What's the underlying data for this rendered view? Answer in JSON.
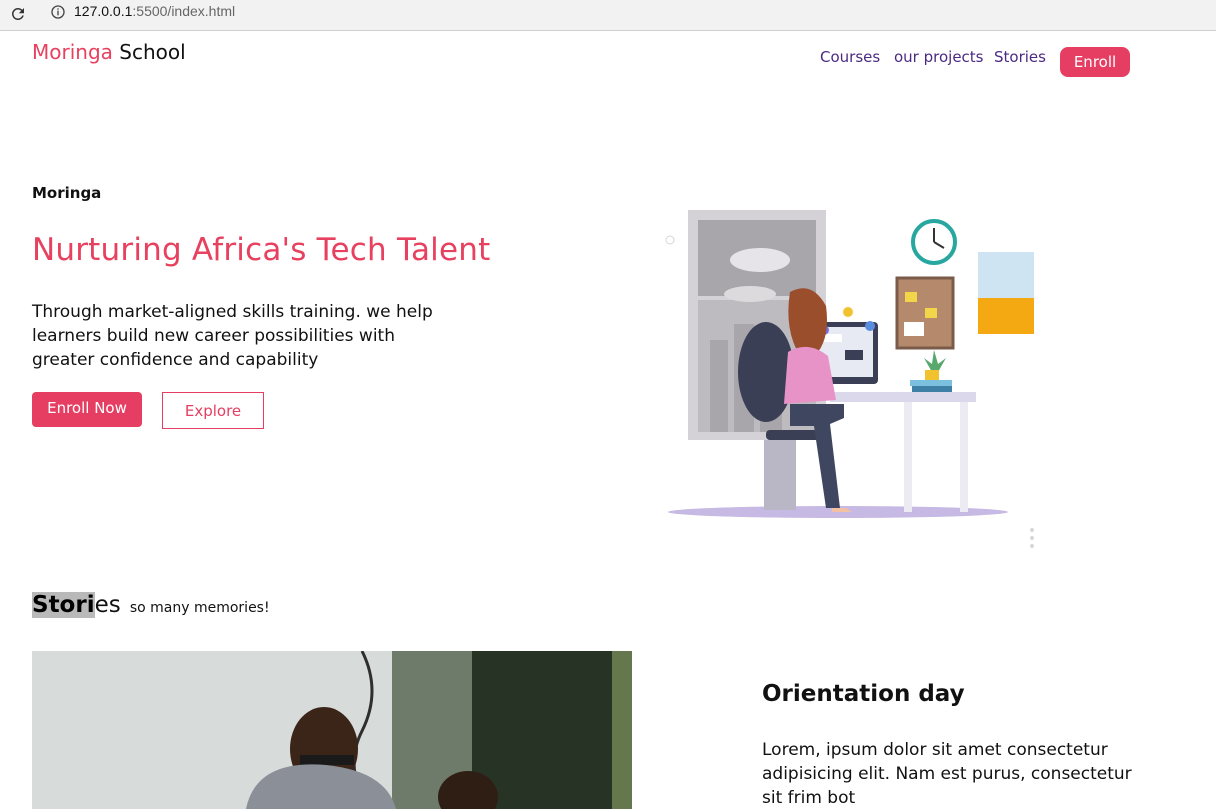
{
  "browser": {
    "url_host": "127.0.0.1",
    "url_path": ":5500/index.html"
  },
  "nav": {
    "brand_first": "Moringa",
    "brand_second": "School",
    "links": [
      "Courses",
      "our projects",
      "Stories"
    ],
    "enroll_label": "Enroll"
  },
  "hero": {
    "eyebrow": "Moringa",
    "title": "Nurturing Africa's Tech Talent",
    "description": "Through market-aligned skills training. we help learners build new career possibilities with greater confidence and capability",
    "primary_button": "Enroll Now",
    "secondary_button": "Explore"
  },
  "stories": {
    "title_highlight": "Stori",
    "title_rest": "es",
    "subtitle": "so many memories!",
    "card_title": "Orientation day",
    "card_text": "Lorem, ipsum dolor sit amet consectetur adipisicing elit. Nam est purus, consectetur sit frim bot"
  },
  "colors": {
    "brand_pink": "#e63e62",
    "nav_purple": "#4b2a83"
  },
  "icons": [
    "reload-icon",
    "info-icon"
  ]
}
